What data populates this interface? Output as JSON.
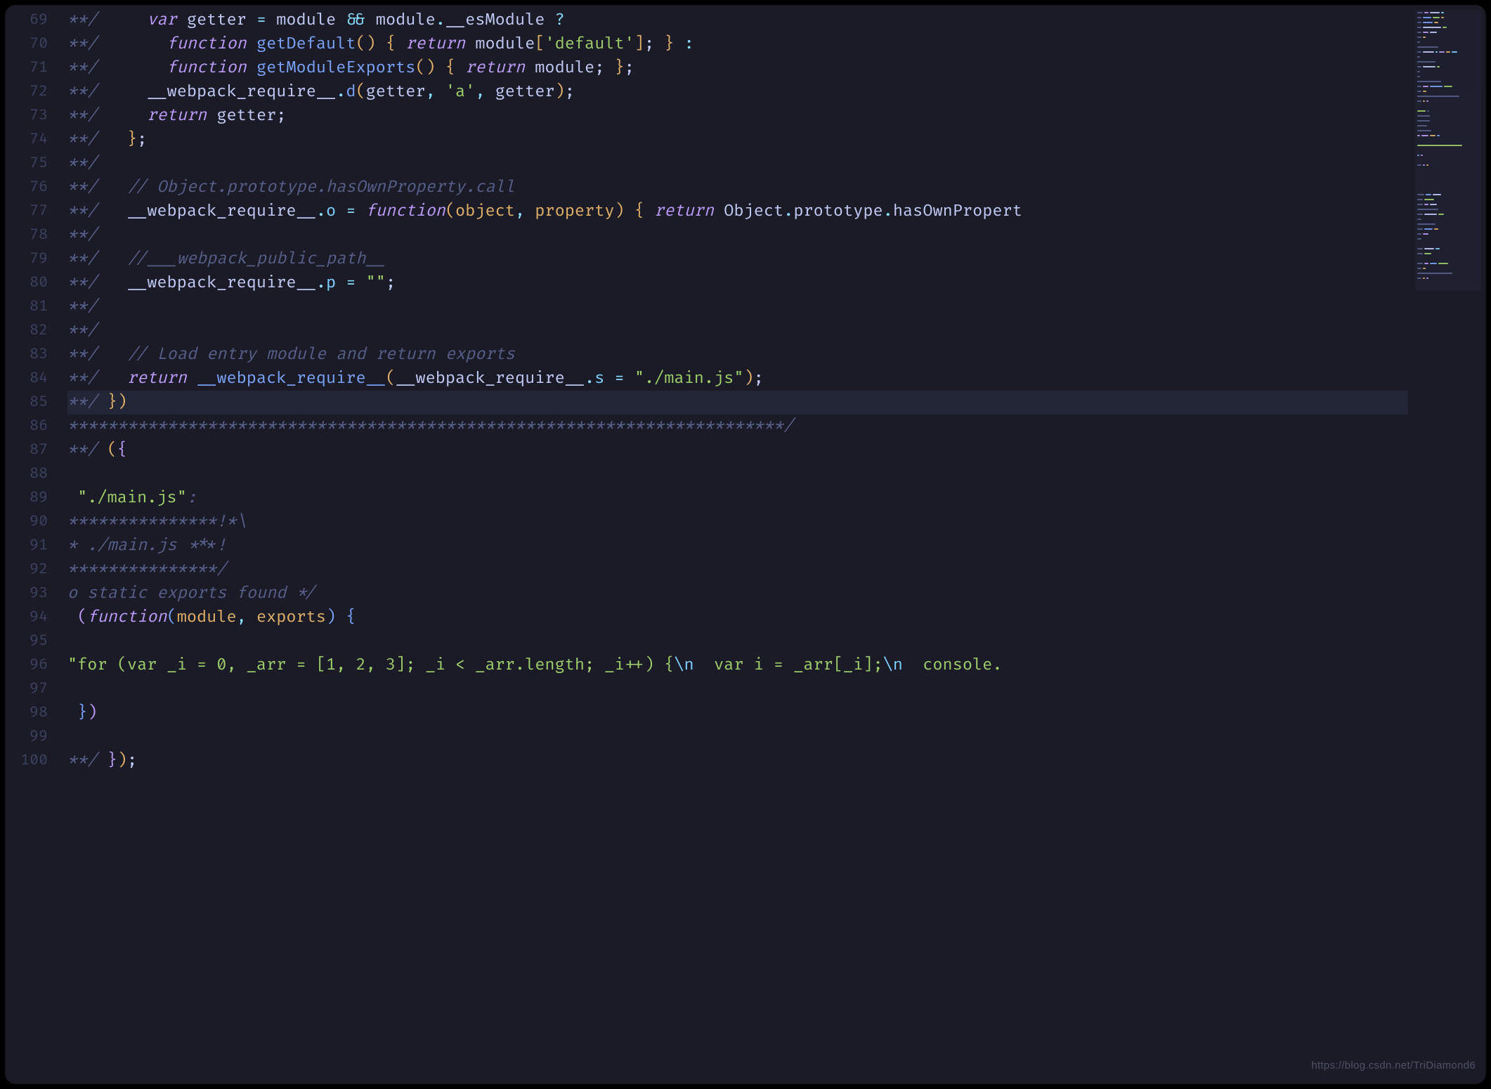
{
  "watermark": "https://blog.csdn.net/TriDiamond6",
  "gutter": {
    "start": 69,
    "end": 100
  },
  "lines": [
    {
      "n": 69,
      "frags": [
        [
          "cm",
          "**/     "
        ],
        [
          "kw",
          "var"
        ],
        [
          "id",
          " getter "
        ],
        [
          "op",
          "="
        ],
        [
          "id",
          " module "
        ],
        [
          "op",
          "&&"
        ],
        [
          "id",
          " module"
        ],
        [
          "op",
          "."
        ],
        [
          "id",
          "__esModule "
        ],
        [
          "op",
          "?"
        ]
      ]
    },
    {
      "n": 70,
      "frags": [
        [
          "cm",
          "**/       "
        ],
        [
          "kw",
          "function"
        ],
        [
          "id",
          " "
        ],
        [
          "fn",
          "getDefault"
        ],
        [
          "py",
          "() { "
        ],
        [
          "kw",
          "return"
        ],
        [
          "id",
          " module"
        ],
        [
          "py",
          "["
        ],
        [
          "str",
          "'default'"
        ],
        [
          "py",
          "]"
        ],
        [
          "id",
          "; "
        ],
        [
          "py",
          "}"
        ],
        [
          "id",
          " "
        ],
        [
          "op",
          ":"
        ]
      ]
    },
    {
      "n": 71,
      "frags": [
        [
          "cm",
          "**/       "
        ],
        [
          "kw",
          "function"
        ],
        [
          "id",
          " "
        ],
        [
          "fn",
          "getModuleExports"
        ],
        [
          "py",
          "() { "
        ],
        [
          "kw",
          "return"
        ],
        [
          "id",
          " module; "
        ],
        [
          "py",
          "}"
        ],
        [
          "id",
          ";"
        ]
      ]
    },
    {
      "n": 72,
      "frags": [
        [
          "cm",
          "**/     "
        ],
        [
          "id",
          "__webpack_require__"
        ],
        [
          "op",
          "."
        ],
        [
          "fn",
          "d"
        ],
        [
          "py",
          "("
        ],
        [
          "id",
          "getter"
        ],
        [
          "op",
          ","
        ],
        [
          "id",
          " "
        ],
        [
          "str",
          "'a'"
        ],
        [
          "op",
          ","
        ],
        [
          "id",
          " getter"
        ],
        [
          "py",
          ")"
        ],
        [
          "id",
          ";"
        ]
      ]
    },
    {
      "n": 73,
      "frags": [
        [
          "cm",
          "**/     "
        ],
        [
          "kw",
          "return"
        ],
        [
          "id",
          " getter;"
        ]
      ]
    },
    {
      "n": 74,
      "frags": [
        [
          "cm",
          "**/   "
        ],
        [
          "py",
          "}"
        ],
        [
          "id",
          ";"
        ]
      ]
    },
    {
      "n": 75,
      "frags": [
        [
          "cm",
          "**/"
        ]
      ]
    },
    {
      "n": 76,
      "frags": [
        [
          "cm",
          "**/   // Object.prototype.hasOwnProperty.call"
        ]
      ]
    },
    {
      "n": 77,
      "frags": [
        [
          "cm",
          "**/   "
        ],
        [
          "id",
          "__webpack_require__"
        ],
        [
          "op",
          "."
        ],
        [
          "prop",
          "o"
        ],
        [
          "id",
          " "
        ],
        [
          "op",
          "="
        ],
        [
          "id",
          " "
        ],
        [
          "kw",
          "function"
        ],
        [
          "py",
          "("
        ],
        [
          "prm",
          "object"
        ],
        [
          "op",
          ","
        ],
        [
          "id",
          " "
        ],
        [
          "prm",
          "property"
        ],
        [
          "py",
          ") { "
        ],
        [
          "kw",
          "return"
        ],
        [
          "id",
          " Object"
        ],
        [
          "op",
          "."
        ],
        [
          "id",
          "prototype"
        ],
        [
          "op",
          "."
        ],
        [
          "id",
          "hasOwnPropert"
        ]
      ]
    },
    {
      "n": 78,
      "frags": [
        [
          "cm",
          "**/"
        ]
      ]
    },
    {
      "n": 79,
      "frags": [
        [
          "cm",
          "**/   //___webpack_public_path__"
        ]
      ],
      "underline": true
    },
    {
      "n": 80,
      "frags": [
        [
          "cm",
          "**/   "
        ],
        [
          "id",
          "__webpack_require__"
        ],
        [
          "op",
          "."
        ],
        [
          "prop",
          "p"
        ],
        [
          "id",
          " "
        ],
        [
          "op",
          "="
        ],
        [
          "id",
          " "
        ],
        [
          "str",
          "\"\""
        ],
        [
          "id",
          ";"
        ]
      ]
    },
    {
      "n": 81,
      "frags": [
        [
          "cm",
          "**/"
        ]
      ]
    },
    {
      "n": 82,
      "frags": [
        [
          "cm",
          "**/"
        ]
      ]
    },
    {
      "n": 83,
      "frags": [
        [
          "cm",
          "**/   // Load entry module and return exports"
        ]
      ]
    },
    {
      "n": 84,
      "frags": [
        [
          "cm",
          "**/   "
        ],
        [
          "kw",
          "return"
        ],
        [
          "id",
          " "
        ],
        [
          "fn",
          "__webpack_require__"
        ],
        [
          "py",
          "("
        ],
        [
          "id",
          "__webpack_require__"
        ],
        [
          "op",
          "."
        ],
        [
          "prop",
          "s"
        ],
        [
          "id",
          " "
        ],
        [
          "op",
          "="
        ],
        [
          "id",
          " "
        ],
        [
          "str",
          "\"./main.js\""
        ],
        [
          "py",
          ")"
        ],
        [
          "id",
          ";"
        ]
      ]
    },
    {
      "n": 85,
      "hl": true,
      "frags": [
        [
          "cm",
          "**/ "
        ],
        [
          "py",
          "}"
        ],
        [
          "py",
          ")"
        ]
      ]
    },
    {
      "n": 86,
      "frags": [
        [
          "cm",
          "************************************************************************/"
        ]
      ]
    },
    {
      "n": 87,
      "frags": [
        [
          "cm",
          "**/ "
        ],
        [
          "py",
          "("
        ],
        [
          "pp",
          "{"
        ]
      ]
    },
    {
      "n": 88,
      "frags": [
        [
          "id",
          " "
        ]
      ]
    },
    {
      "n": 89,
      "frags": [
        [
          "id",
          " "
        ],
        [
          "str",
          "\"./main.js\""
        ],
        [
          "cm ital",
          ":"
        ]
      ]
    },
    {
      "n": 90,
      "frags": [
        [
          "cm",
          "***************!*\\"
        ]
      ]
    },
    {
      "n": 91,
      "frags": [
        [
          "cm",
          "* ./main.js ***!"
        ]
      ]
    },
    {
      "n": 92,
      "frags": [
        [
          "cm",
          "***************/"
        ]
      ]
    },
    {
      "n": 93,
      "frags": [
        [
          "cm",
          "o static exports found */"
        ]
      ]
    },
    {
      "n": 94,
      "frags": [
        [
          "id",
          " "
        ],
        [
          "pp",
          "("
        ],
        [
          "kw",
          "function"
        ],
        [
          "pb",
          "("
        ],
        [
          "prm",
          "module"
        ],
        [
          "op",
          ","
        ],
        [
          "id",
          " "
        ],
        [
          "prm",
          "exports"
        ],
        [
          "pb",
          ")"
        ],
        [
          "id",
          " "
        ],
        [
          "pb",
          "{"
        ]
      ]
    },
    {
      "n": 95,
      "frags": [
        [
          "id",
          " "
        ]
      ]
    },
    {
      "n": 96,
      "frags": [
        [
          "str",
          "\"for (var _i = 0, _arr = [1, 2, 3]; _i < _arr.length; _i++) {"
        ],
        [
          "prop",
          "\\n"
        ],
        [
          "str",
          "  var i = _arr[_i];"
        ],
        [
          "prop",
          "\\n"
        ],
        [
          "str",
          "  console."
        ]
      ]
    },
    {
      "n": 97,
      "frags": [
        [
          "id",
          " "
        ]
      ]
    },
    {
      "n": 98,
      "frags": [
        [
          "id",
          " "
        ],
        [
          "pb",
          "}"
        ],
        [
          "pp",
          ")"
        ]
      ]
    },
    {
      "n": 99,
      "frags": [
        [
          "id",
          " "
        ]
      ]
    },
    {
      "n": 100,
      "frags": [
        [
          "cm",
          "**/ "
        ],
        [
          "pp",
          "}"
        ],
        [
          "py",
          ")"
        ],
        [
          "id",
          ";"
        ]
      ]
    }
  ],
  "minimap_rows": [
    [
      [
        "#565f89",
        8
      ],
      [
        "#bb9af7",
        6
      ],
      [
        "#c0caf5",
        14
      ],
      [
        "#89ddff",
        4
      ]
    ],
    [
      [
        "#565f89",
        6
      ],
      [
        "#7aa2f7",
        12
      ],
      [
        "#9ece6a",
        10
      ],
      [
        "#e0af68",
        4
      ]
    ],
    [
      [
        "#565f89",
        6
      ],
      [
        "#7aa2f7",
        14
      ],
      [
        "#e0af68",
        6
      ]
    ],
    [
      [
        "#565f89",
        6
      ],
      [
        "#c0caf5",
        26
      ],
      [
        "#9ece6a",
        6
      ]
    ],
    [
      [
        "#565f89",
        6
      ],
      [
        "#bb9af7",
        8
      ],
      [
        "#c0caf5",
        10
      ]
    ],
    [
      [
        "#565f89",
        6
      ],
      [
        "#e0af68",
        4
      ]
    ],
    [
      [
        "#565f89",
        4
      ]
    ],
    [
      [
        "#565f89",
        30
      ]
    ],
    [
      [
        "#565f89",
        6
      ],
      [
        "#c0caf5",
        16
      ],
      [
        "#89ddff",
        3
      ],
      [
        "#bb9af7",
        8
      ],
      [
        "#e0af68",
        6
      ],
      [
        "#7dcfff",
        8
      ]
    ],
    [
      [
        "#565f89",
        4
      ]
    ],
    [
      [
        "#565f89",
        26
      ]
    ],
    [
      [
        "#565f89",
        6
      ],
      [
        "#c0caf5",
        18
      ],
      [
        "#9ece6a",
        4
      ]
    ],
    [
      [
        "#565f89",
        4
      ]
    ],
    [
      [
        "#565f89",
        4
      ]
    ],
    [
      [
        "#565f89",
        34
      ]
    ],
    [
      [
        "#565f89",
        6
      ],
      [
        "#bb9af7",
        8
      ],
      [
        "#7aa2f7",
        18
      ],
      [
        "#9ece6a",
        12
      ]
    ],
    [
      [
        "#565f89",
        6
      ],
      [
        "#e0af68",
        5
      ]
    ],
    [
      [
        "#565f89",
        60
      ]
    ],
    [
      [
        "#565f89",
        6
      ],
      [
        "#e0af68",
        3
      ],
      [
        "#bb9af7",
        3
      ]
    ],
    [],
    [
      [
        "#9ece6a",
        12
      ],
      [
        "#565f89",
        3
      ]
    ],
    [
      [
        "#565f89",
        18
      ]
    ],
    [
      [
        "#565f89",
        18
      ]
    ],
    [
      [
        "#565f89",
        14
      ]
    ],
    [
      [
        "#565f89",
        20
      ]
    ],
    [
      [
        "#bb9af7",
        4
      ],
      [
        "#bb9af7",
        10
      ],
      [
        "#e0af68",
        8
      ],
      [
        "#7aa2f7",
        4
      ]
    ],
    [],
    [
      [
        "#9ece6a",
        64
      ]
    ],
    [],
    [
      [
        "#7aa2f7",
        3
      ],
      [
        "#bb9af7",
        3
      ]
    ],
    [],
    [
      [
        "#565f89",
        6
      ],
      [
        "#bb9af7",
        3
      ],
      [
        "#e0af68",
        3
      ]
    ],
    [],
    [],
    [],
    [],
    [],
    [
      [
        "#565f89",
        10
      ],
      [
        "#7aa2f7",
        8
      ],
      [
        "#c0caf5",
        12
      ]
    ],
    [
      [
        "#565f89",
        8
      ],
      [
        "#9ece6a",
        14
      ]
    ],
    [
      [
        "#565f89",
        8
      ],
      [
        "#bb9af7",
        6
      ],
      [
        "#c0caf5",
        10
      ]
    ],
    [
      [
        "#565f89",
        30
      ]
    ],
    [
      [
        "#565f89",
        8
      ],
      [
        "#c0caf5",
        18
      ],
      [
        "#9ece6a",
        8
      ]
    ],
    [
      [
        "#565f89",
        6
      ]
    ],
    [
      [
        "#565f89",
        26
      ]
    ],
    [
      [
        "#565f89",
        8
      ],
      [
        "#7aa2f7",
        12
      ],
      [
        "#e0af68",
        6
      ]
    ],
    [
      [
        "#565f89",
        6
      ],
      [
        "#bb9af7",
        8
      ]
    ],
    [
      [
        "#565f89",
        6
      ]
    ],
    [],
    [
      [
        "#565f89",
        8
      ],
      [
        "#c0caf5",
        14
      ],
      [
        "#7dcfff",
        6
      ]
    ],
    [
      [
        "#565f89",
        8
      ],
      [
        "#9ece6a",
        10
      ]
    ],
    [],
    [
      [
        "#565f89",
        8
      ],
      [
        "#bb9af7",
        6
      ],
      [
        "#7aa2f7",
        10
      ],
      [
        "#9ece6a",
        14
      ]
    ],
    [
      [
        "#565f89",
        6
      ],
      [
        "#e0af68",
        4
      ]
    ],
    [
      [
        "#565f89",
        50
      ]
    ],
    [
      [
        "#565f89",
        6
      ],
      [
        "#e0af68",
        3
      ],
      [
        "#bb9af7",
        3
      ]
    ]
  ]
}
